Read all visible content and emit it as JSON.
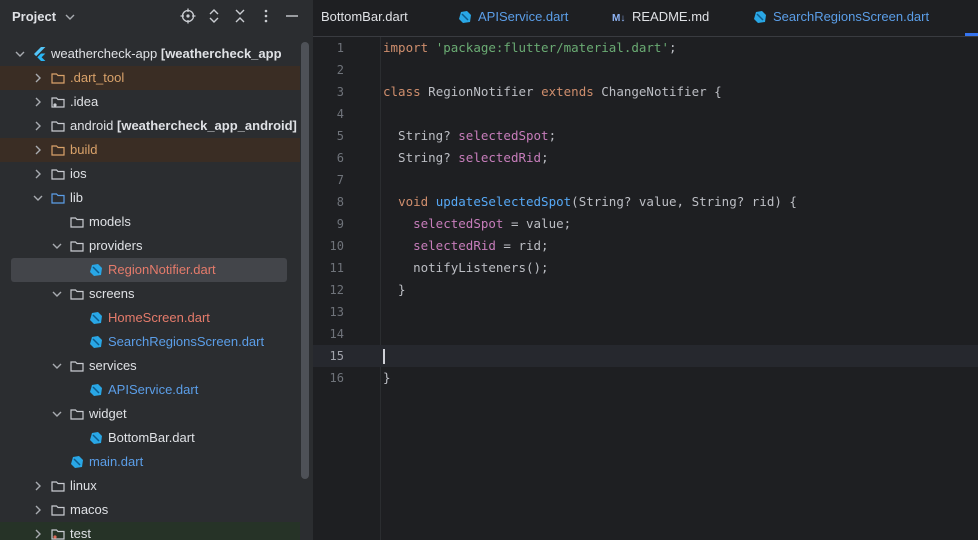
{
  "panel": {
    "title": "Project",
    "tree": [
      {
        "label": "weathercheck-app",
        "suffix": "[weathercheck_app",
        "icon": "flutter-icon",
        "expanded": true
      },
      {
        "label": ".dart_tool",
        "icon": "folder-icon",
        "expanded": false
      },
      {
        "label": ".idea",
        "icon": "folder-icon",
        "expanded": false
      },
      {
        "label": "android",
        "suffix": "[weathercheck_app_android]",
        "icon": "folder-icon",
        "expanded": false
      },
      {
        "label": "build",
        "icon": "folder-icon",
        "expanded": false
      },
      {
        "label": "ios",
        "icon": "folder-icon",
        "expanded": false
      },
      {
        "label": "lib",
        "icon": "folder-icon",
        "expanded": true
      },
      {
        "label": "models",
        "icon": "folder-icon"
      },
      {
        "label": "providers",
        "icon": "folder-icon",
        "expanded": true
      },
      {
        "label": "RegionNotifier.dart",
        "icon": "dart-icon"
      },
      {
        "label": "screens",
        "icon": "folder-icon",
        "expanded": true
      },
      {
        "label": "HomeScreen.dart",
        "icon": "dart-icon"
      },
      {
        "label": "SearchRegionsScreen.dart",
        "icon": "dart-icon"
      },
      {
        "label": "services",
        "icon": "folder-icon",
        "expanded": true
      },
      {
        "label": "APIService.dart",
        "icon": "dart-icon"
      },
      {
        "label": "widget",
        "icon": "folder-icon",
        "expanded": true
      },
      {
        "label": "BottomBar.dart",
        "icon": "dart-icon"
      },
      {
        "label": "main.dart",
        "icon": "dart-icon"
      },
      {
        "label": "linux",
        "icon": "folder-icon",
        "expanded": false
      },
      {
        "label": "macos",
        "icon": "folder-icon",
        "expanded": false
      },
      {
        "label": "test",
        "icon": "folder-icon",
        "expanded": false
      }
    ]
  },
  "tabs": [
    {
      "label": "BottomBar.dart"
    },
    {
      "label": "APIService.dart",
      "icon": "dart-icon"
    },
    {
      "label": "README.md",
      "icon": "markdown-icon",
      "icon_text": "M↓"
    },
    {
      "label": "SearchRegionsScreen.dart",
      "icon": "dart-icon"
    }
  ],
  "editor": {
    "current_line": 15,
    "lines": [
      {
        "num": "1",
        "tokens": [
          {
            "t": "kw",
            "v": "import"
          },
          {
            "t": "p",
            "v": " "
          },
          {
            "t": "str",
            "v": "'package:flutter/material.dart'"
          },
          {
            "t": "p",
            "v": ";"
          }
        ]
      },
      {
        "num": "2",
        "tokens": []
      },
      {
        "num": "3",
        "tokens": [
          {
            "t": "kw",
            "v": "class"
          },
          {
            "t": "p",
            "v": " RegionNotifier "
          },
          {
            "t": "kw",
            "v": "extends"
          },
          {
            "t": "p",
            "v": " ChangeNotifier {"
          }
        ]
      },
      {
        "num": "4",
        "tokens": []
      },
      {
        "num": "5",
        "tokens": [
          {
            "t": "p",
            "v": "  String? "
          },
          {
            "t": "fld",
            "v": "selectedSpot"
          },
          {
            "t": "p",
            "v": ";"
          }
        ]
      },
      {
        "num": "6",
        "tokens": [
          {
            "t": "p",
            "v": "  String? "
          },
          {
            "t": "fld",
            "v": "selectedRid"
          },
          {
            "t": "p",
            "v": ";"
          }
        ]
      },
      {
        "num": "7",
        "tokens": []
      },
      {
        "num": "8",
        "tokens": [
          {
            "t": "p",
            "v": "  "
          },
          {
            "t": "kw",
            "v": "void"
          },
          {
            "t": "p",
            "v": " "
          },
          {
            "t": "fn",
            "v": "updateSelectedSpot"
          },
          {
            "t": "p",
            "v": "(String? value, String? rid) {"
          }
        ]
      },
      {
        "num": "9",
        "tokens": [
          {
            "t": "p",
            "v": "    "
          },
          {
            "t": "fld",
            "v": "selectedSpot"
          },
          {
            "t": "p",
            "v": " = value;"
          }
        ]
      },
      {
        "num": "10",
        "tokens": [
          {
            "t": "p",
            "v": "    "
          },
          {
            "t": "fld",
            "v": "selectedRid"
          },
          {
            "t": "p",
            "v": " = rid;"
          }
        ]
      },
      {
        "num": "11",
        "tokens": [
          {
            "t": "p",
            "v": "    notifyListeners();"
          }
        ]
      },
      {
        "num": "12",
        "tokens": [
          {
            "t": "p",
            "v": "  }"
          }
        ]
      },
      {
        "num": "13",
        "tokens": []
      },
      {
        "num": "14",
        "tokens": []
      },
      {
        "num": "15",
        "tokens": []
      },
      {
        "num": "16",
        "tokens": [
          {
            "t": "p",
            "v": "}"
          }
        ]
      }
    ]
  },
  "colors": {
    "excluded_folder": "#d9a26a",
    "modified_file": "#e57b6b",
    "new_file": "#5b9ee8",
    "keyword": "#cf8e6d",
    "string": "#6aab73",
    "field": "#c77dbb",
    "function": "#56a8f5"
  }
}
